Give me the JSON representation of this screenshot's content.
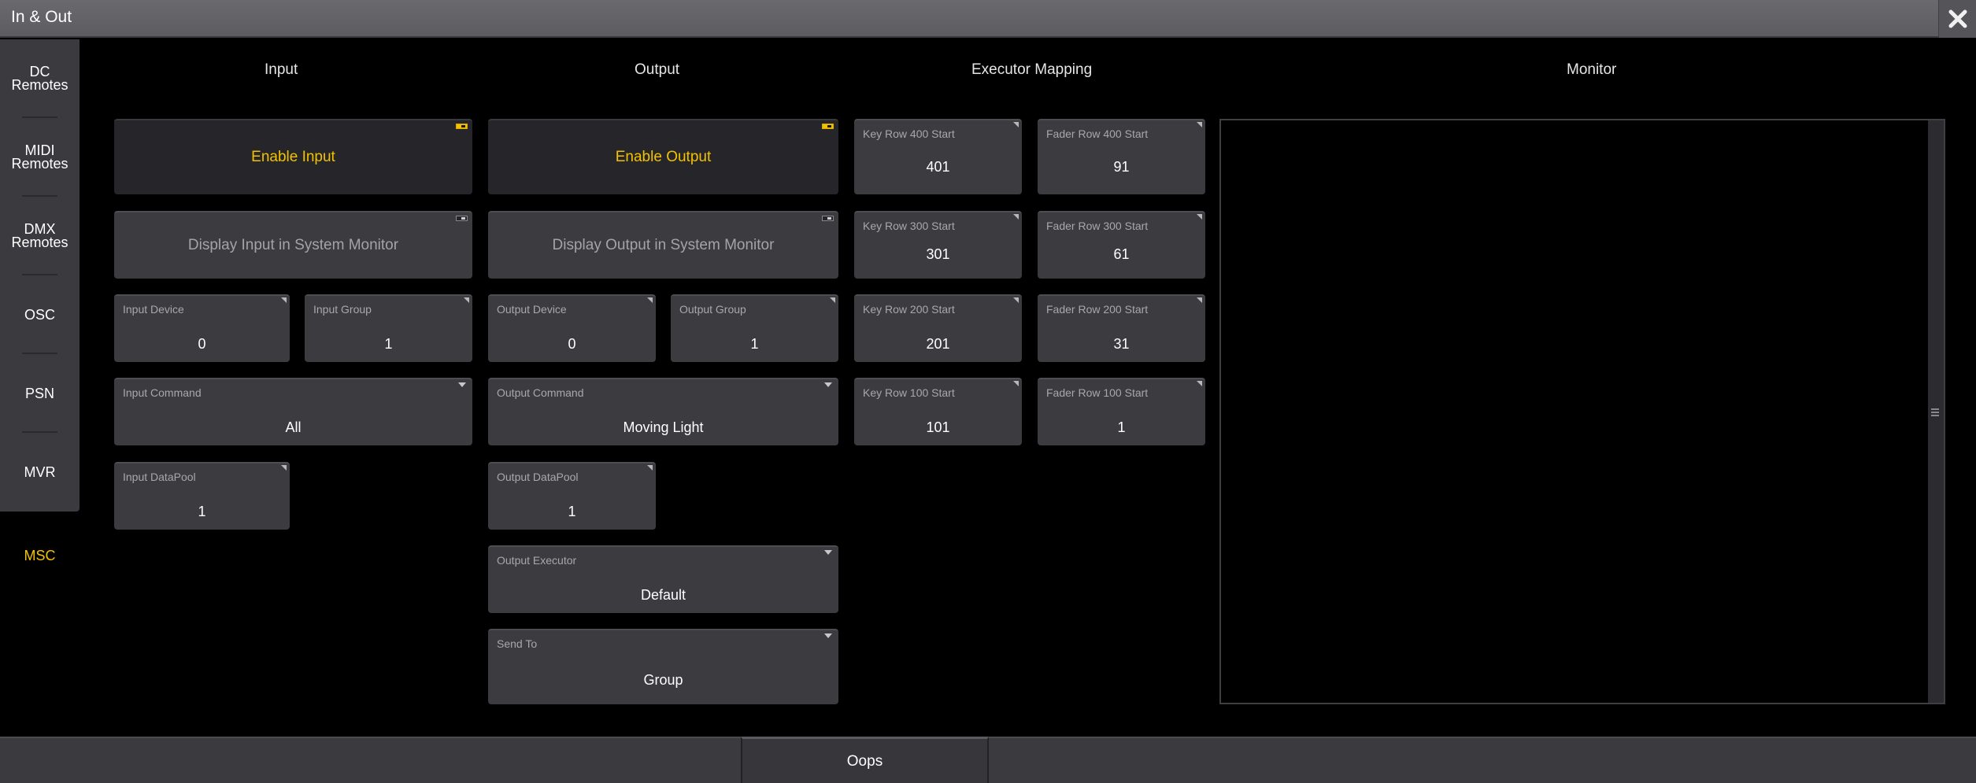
{
  "window": {
    "title": "In & Out"
  },
  "sidebar": {
    "items": [
      {
        "label": "DC\nRemotes"
      },
      {
        "label": "MIDI\nRemotes"
      },
      {
        "label": "DMX\nRemotes"
      },
      {
        "label": "OSC"
      },
      {
        "label": "PSN"
      },
      {
        "label": "MVR"
      },
      {
        "label": "MSC",
        "active": true
      }
    ]
  },
  "headers": {
    "input": "Input",
    "output": "Output",
    "executor_mapping": "Executor Mapping",
    "monitor": "Monitor"
  },
  "input": {
    "enable": "Enable Input",
    "display": "Display Input in System Monitor",
    "device": {
      "label": "Input Device",
      "value": "0"
    },
    "group": {
      "label": "Input Group",
      "value": "1"
    },
    "command": {
      "label": "Input Command",
      "value": "All"
    },
    "datapool": {
      "label": "Input DataPool",
      "value": "1"
    }
  },
  "output": {
    "enable": "Enable Output",
    "display": "Display Output in System Monitor",
    "device": {
      "label": "Output Device",
      "value": "0"
    },
    "group": {
      "label": "Output Group",
      "value": "1"
    },
    "command": {
      "label": "Output Command",
      "value": "Moving Light"
    },
    "datapool": {
      "label": "Output DataPool",
      "value": "1"
    },
    "executor": {
      "label": "Output Executor",
      "value": "Default"
    },
    "send_to": {
      "label": "Send To",
      "value": "Group"
    }
  },
  "executor_mapping": {
    "key_rows": [
      {
        "label": "Key Row 400 Start",
        "value": "401"
      },
      {
        "label": "Key Row 300 Start",
        "value": "301"
      },
      {
        "label": "Key Row 200 Start",
        "value": "201"
      },
      {
        "label": "Key Row 100 Start",
        "value": "101"
      }
    ],
    "fader_rows": [
      {
        "label": "Fader Row 400 Start",
        "value": "91"
      },
      {
        "label": "Fader Row 300 Start",
        "value": "61"
      },
      {
        "label": "Fader Row 200 Start",
        "value": "31"
      },
      {
        "label": "Fader Row 100 Start",
        "value": "1"
      }
    ]
  },
  "bottom": {
    "oops": "Oops"
  },
  "colors": {
    "accent": "#f2c200",
    "tile": "#3b3b40",
    "background": "#000000"
  },
  "icons": {
    "close": "close-icon"
  }
}
